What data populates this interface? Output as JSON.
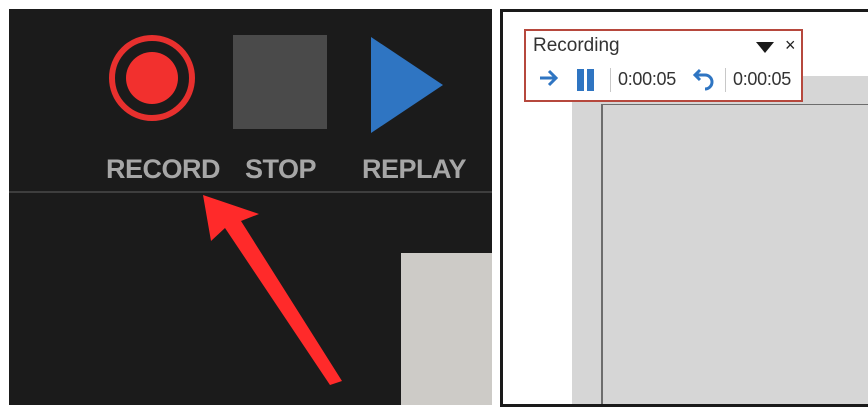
{
  "left_toolbar": {
    "record_label": "RECORD",
    "stop_label": "STOP",
    "replay_label": "REPLAY"
  },
  "recording_toolbar": {
    "title": "Recording",
    "close_glyph": "×",
    "slide_time": "0:00:05",
    "total_time": "0:00:05"
  },
  "icons": {
    "record": "record-icon",
    "stop": "stop-icon",
    "replay": "play-icon",
    "next": "right-arrow-icon",
    "pause": "pause-icon",
    "repeat": "undo-arrow-icon",
    "menu": "dropdown-triangle-icon",
    "close": "close-icon"
  },
  "colors": {
    "record_red": "#f2302e",
    "replay_blue": "#2f75c2",
    "toolbar_highlight": "#b6483d",
    "annotation_arrow": "#ff2a2a",
    "label_gray": "#a6a6a6"
  }
}
